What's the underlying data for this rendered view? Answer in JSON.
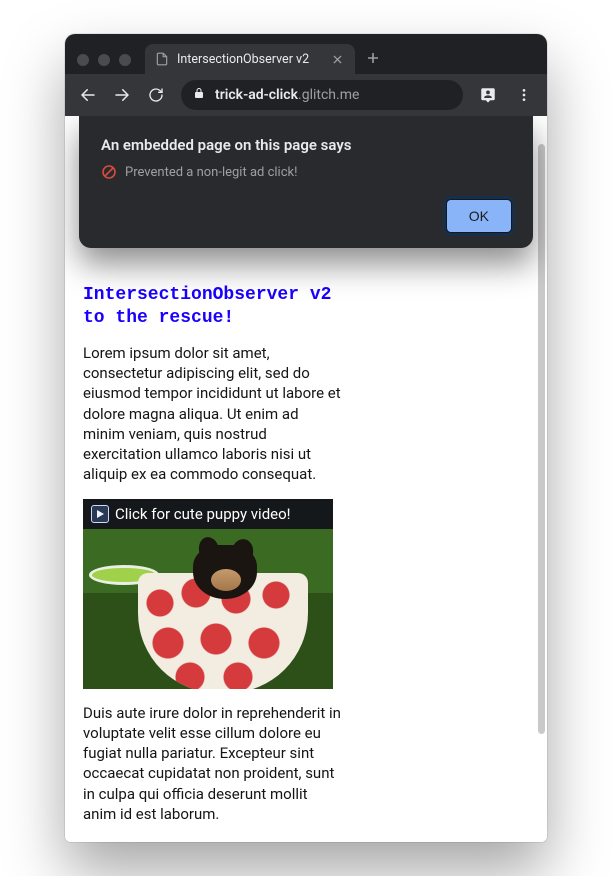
{
  "browser": {
    "tab_title": "IntersectionObserver v2",
    "url_host": "trick-ad-click",
    "url_rest": ".glitch.me"
  },
  "dialog": {
    "title": "An embedded page on this page says",
    "message": "Prevented a non-legit ad click!",
    "ok_label": "OK"
  },
  "page": {
    "heading": "IntersectionObserver v2 to the rescue!",
    "para1": "Lorem ipsum dolor sit amet, consectetur adipiscing elit, sed do eiusmod tempor incididunt ut labore et dolore magna aliqua. Ut enim ad minim veniam, quis nostrud exercitation ullamco laboris nisi ut aliquip ex ea commodo consequat.",
    "video_caption": "Click for cute puppy video!",
    "para2": "Duis aute irure dolor in reprehenderit in voluptate velit esse cillum dolore eu fugiat nulla pariatur. Excepteur sint occaecat cupidatat non proident, sunt in culpa qui officia deserunt mollit anim id est laborum."
  }
}
